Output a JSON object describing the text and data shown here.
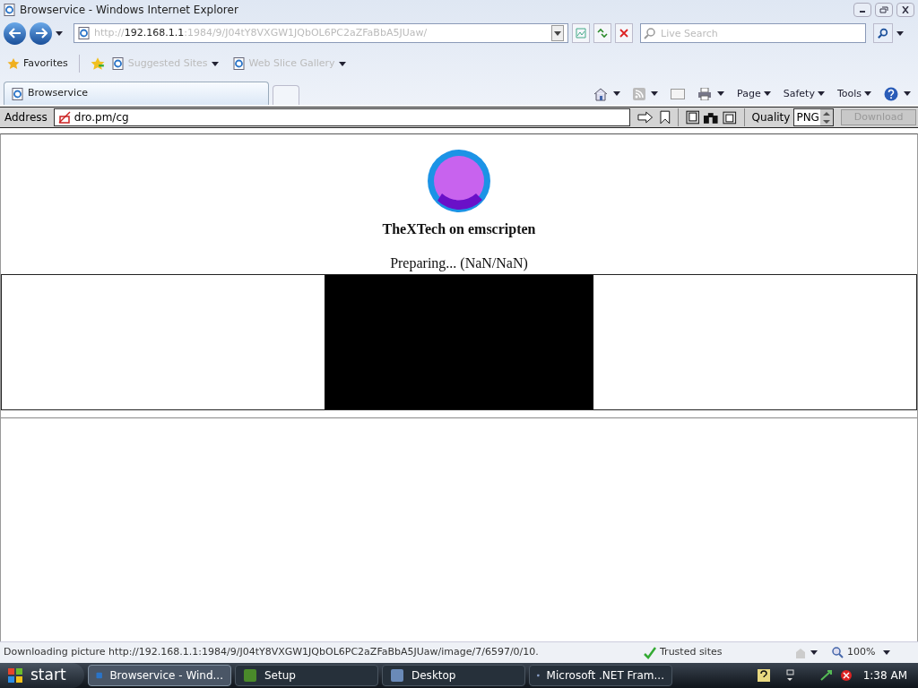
{
  "window": {
    "title": "Browservice - Windows Internet Explorer"
  },
  "nav": {
    "url_scheme": "http://",
    "url_host": "192.168.1.1",
    "url_rest": ":1984/9/J04tY8VXGW1JQbOL6PC2aZFaBbA5JUaw/",
    "search_placeholder": "Live Search"
  },
  "favorites_bar": {
    "favorites": "Favorites",
    "links": [
      "Suggested Sites",
      "Web Slice Gallery"
    ]
  },
  "tabs": [
    {
      "label": "Browservice",
      "selected": true
    }
  ],
  "command_bar": [
    "Page",
    "Safety",
    "Tools"
  ],
  "page_toolbar": {
    "address_label": "Address",
    "address": "dro.pm/cg",
    "quality_label": "Quality",
    "quality": "PNG",
    "download": "Download",
    "download_disabled": true
  },
  "page": {
    "title": "TheXTech on emscripten",
    "status": "Preparing... (NaN/NaN)"
  },
  "status_bar": {
    "text": "Downloading picture http://192.168.1.1:1984/9/J04tY8VXGW1JQbOL6PC2aZFaBbA5JUaw/image/7/6597/0/10.",
    "zone": "Trusted sites",
    "zoom": "100%"
  },
  "taskbar": {
    "start": "start",
    "items": [
      {
        "label": "Browservice - Wind...",
        "selected": true
      },
      {
        "label": "Setup",
        "selected": false
      },
      {
        "label": "Desktop",
        "selected": false
      },
      {
        "label": "Microsoft .NET Fram...",
        "selected": false
      }
    ],
    "clock": "1:38 AM"
  }
}
